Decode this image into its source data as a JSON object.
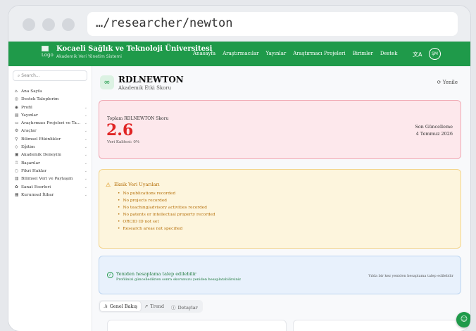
{
  "browser": {
    "url": "…/researcher/newton"
  },
  "navbar": {
    "logo_alt": "Logo",
    "brand_title": "Kocaeli Sağlık ve Teknoloji Üniversitesi",
    "brand_subtitle": "Akademik Veri Yönetim Sistemi",
    "links": [
      "Anasayfa",
      "Araştırmacılar",
      "Yayınlar",
      "Araştırmacı Projeleri",
      "Birimler",
      "Destek"
    ],
    "translate_glyph": "文A",
    "avatar_initials": "ŞM"
  },
  "sidebar": {
    "search_placeholder": "Search...",
    "items": [
      {
        "label": "Ana Sayfa",
        "icon": "⌂",
        "chevron": false
      },
      {
        "label": "Destek Taleplerim",
        "icon": "◎",
        "chevron": false
      },
      {
        "label": "Profil",
        "icon": "◉",
        "chevron": true
      },
      {
        "label": "Yayınlar",
        "icon": "▤",
        "chevron": true
      },
      {
        "label": "Araştırmacı Projeleri ve Ta...",
        "icon": "▭",
        "chevron": true
      },
      {
        "label": "Araçlar",
        "icon": "⚙",
        "chevron": true
      },
      {
        "label": "Bilimsel Etkinlikler",
        "icon": "⚲",
        "chevron": true
      },
      {
        "label": "Eğitim",
        "icon": "◇",
        "chevron": true
      },
      {
        "label": "Akademik Deneyim",
        "icon": "▣",
        "chevron": true
      },
      {
        "label": "Başarılar",
        "icon": "♖",
        "chevron": true
      },
      {
        "label": "Fikri Haklar",
        "icon": "○",
        "chevron": true
      },
      {
        "label": "Bilimsel Veri ve Paylaşım",
        "icon": "▥",
        "chevron": true
      },
      {
        "label": "Sanat Eserleri",
        "icon": "✿",
        "chevron": true
      },
      {
        "label": "Kurumsal İtibar",
        "icon": "▦",
        "chevron": true
      }
    ]
  },
  "header": {
    "icon_glyph": "∞",
    "title": "RDLNEWTON",
    "subtitle": "Akademik Etki Skoru",
    "refresh_label": "Yenile",
    "refresh_glyph": "⟳"
  },
  "score_card": {
    "label": "Toplam RDLNEWTON Skoru",
    "value": "2.6",
    "quality": "Veri Kalitesi: 0%",
    "updated_label": "Son Güncelleme",
    "updated_date": "4 Temmuz 2026",
    "accent": "#e02424"
  },
  "warnings": {
    "glyph": "⚠",
    "title": "Eksik Veri Uyarıları",
    "items": [
      "No publications recorded",
      "No projects recorded",
      "No teaching/advisory activities recorded",
      "No patents or intellectual property recorded",
      "ORCID ID not set",
      "Research areas not specified"
    ]
  },
  "recalc": {
    "glyph": "✓",
    "title": "Yeniden hesaplama talep edilebilir",
    "subtitle": "Profilinizi güncelledikten sonra skorunuzu yeniden hesaplatabilirsiniz",
    "note": "Yılda bir kez yeniden hesaplama talep edilebilir"
  },
  "tabs": [
    {
      "label": "Genel Bakış",
      "glyph": ".lı",
      "active": true
    },
    {
      "label": "Trend",
      "glyph": "↗",
      "active": false
    },
    {
      "label": "Detaylar",
      "glyph": "ⓘ",
      "active": false
    }
  ],
  "fab_glyph": "☺",
  "colors": {
    "brand_green": "#1f9a4a",
    "score_red": "#e02424",
    "warning_text": "#b26a00"
  }
}
